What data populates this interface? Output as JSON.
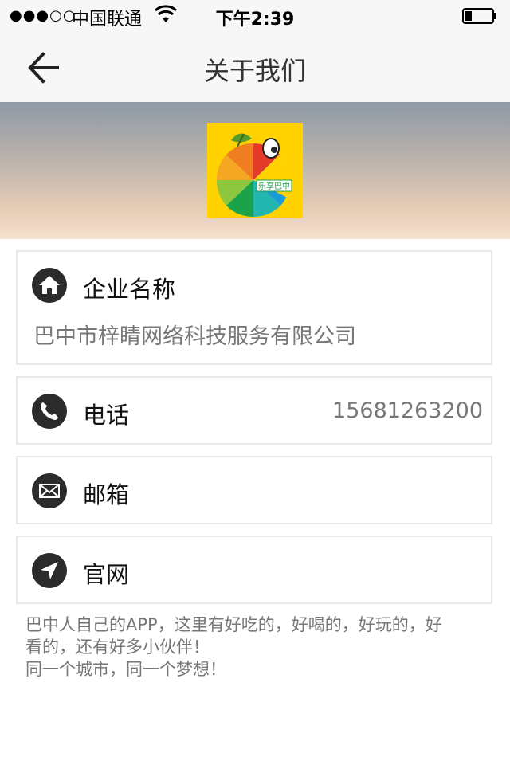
{
  "status_bar": {
    "signal": "●●●○○",
    "carrier": "中国联通",
    "time": "下午2:39"
  },
  "nav": {
    "title": "关于我们",
    "back_icon": "arrow-left-icon"
  },
  "banner": {
    "logo_text": "乐享巴中"
  },
  "company": {
    "icon": "home-icon",
    "label": "企业名称",
    "value": "巴中市梓睛网络科技服务有限公司"
  },
  "phone": {
    "icon": "phone-icon",
    "label": "电话",
    "value": "15681263200"
  },
  "email": {
    "icon": "mail-icon",
    "label": "邮箱"
  },
  "website": {
    "icon": "location-arrow-icon",
    "label": "官网"
  },
  "description": "巴中人自己的APP，这里有好吃的，好喝的，好玩的，好看的，还有好多小伙伴！\n同一个城市，同一个梦想！",
  "colors": {
    "icon_bg": "#2b2b2b",
    "logo_bg": "#ffd200",
    "secondary_text": "#777777"
  }
}
